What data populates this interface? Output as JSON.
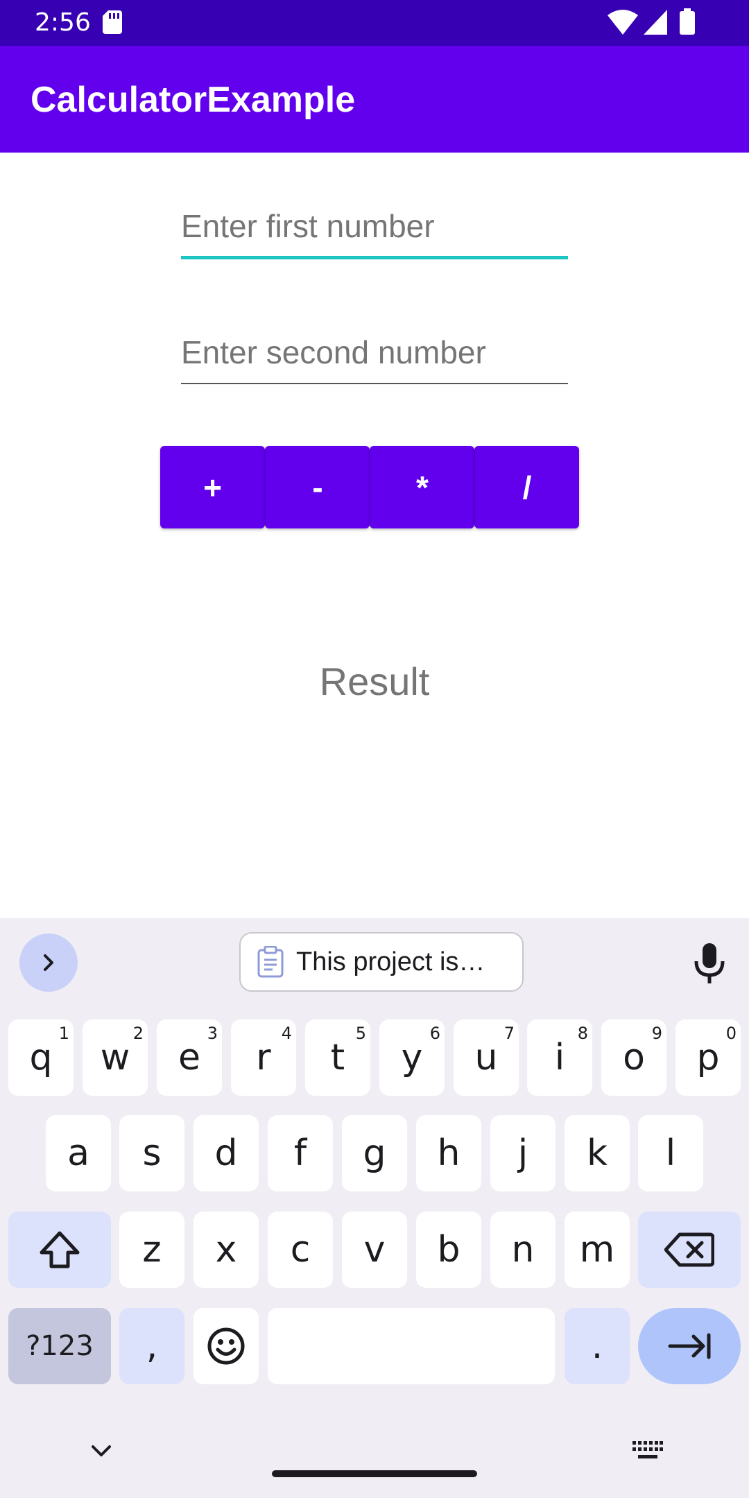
{
  "status_bar": {
    "time": "2:56"
  },
  "app_bar": {
    "title": "CalculatorExample"
  },
  "form": {
    "first_placeholder": "Enter first number",
    "second_placeholder": "Enter second number"
  },
  "operations": [
    "+",
    "-",
    "*",
    "/"
  ],
  "result_label": "Result",
  "keyboard": {
    "suggestion_chip": "This project is…",
    "row1": [
      {
        "k": "q",
        "h": "1"
      },
      {
        "k": "w",
        "h": "2"
      },
      {
        "k": "e",
        "h": "3"
      },
      {
        "k": "r",
        "h": "4"
      },
      {
        "k": "t",
        "h": "5"
      },
      {
        "k": "y",
        "h": "6"
      },
      {
        "k": "u",
        "h": "7"
      },
      {
        "k": "i",
        "h": "8"
      },
      {
        "k": "o",
        "h": "9"
      },
      {
        "k": "p",
        "h": "0"
      }
    ],
    "row2": [
      "a",
      "s",
      "d",
      "f",
      "g",
      "h",
      "j",
      "k",
      "l"
    ],
    "row3": [
      "z",
      "x",
      "c",
      "v",
      "b",
      "n",
      "m"
    ],
    "symbols_label": "?123",
    "comma_label": ",",
    "period_label": "."
  },
  "colors": {
    "status_bar": "#3700b3",
    "primary": "#6200ee",
    "focus_accent": "#1cc7c3"
  }
}
